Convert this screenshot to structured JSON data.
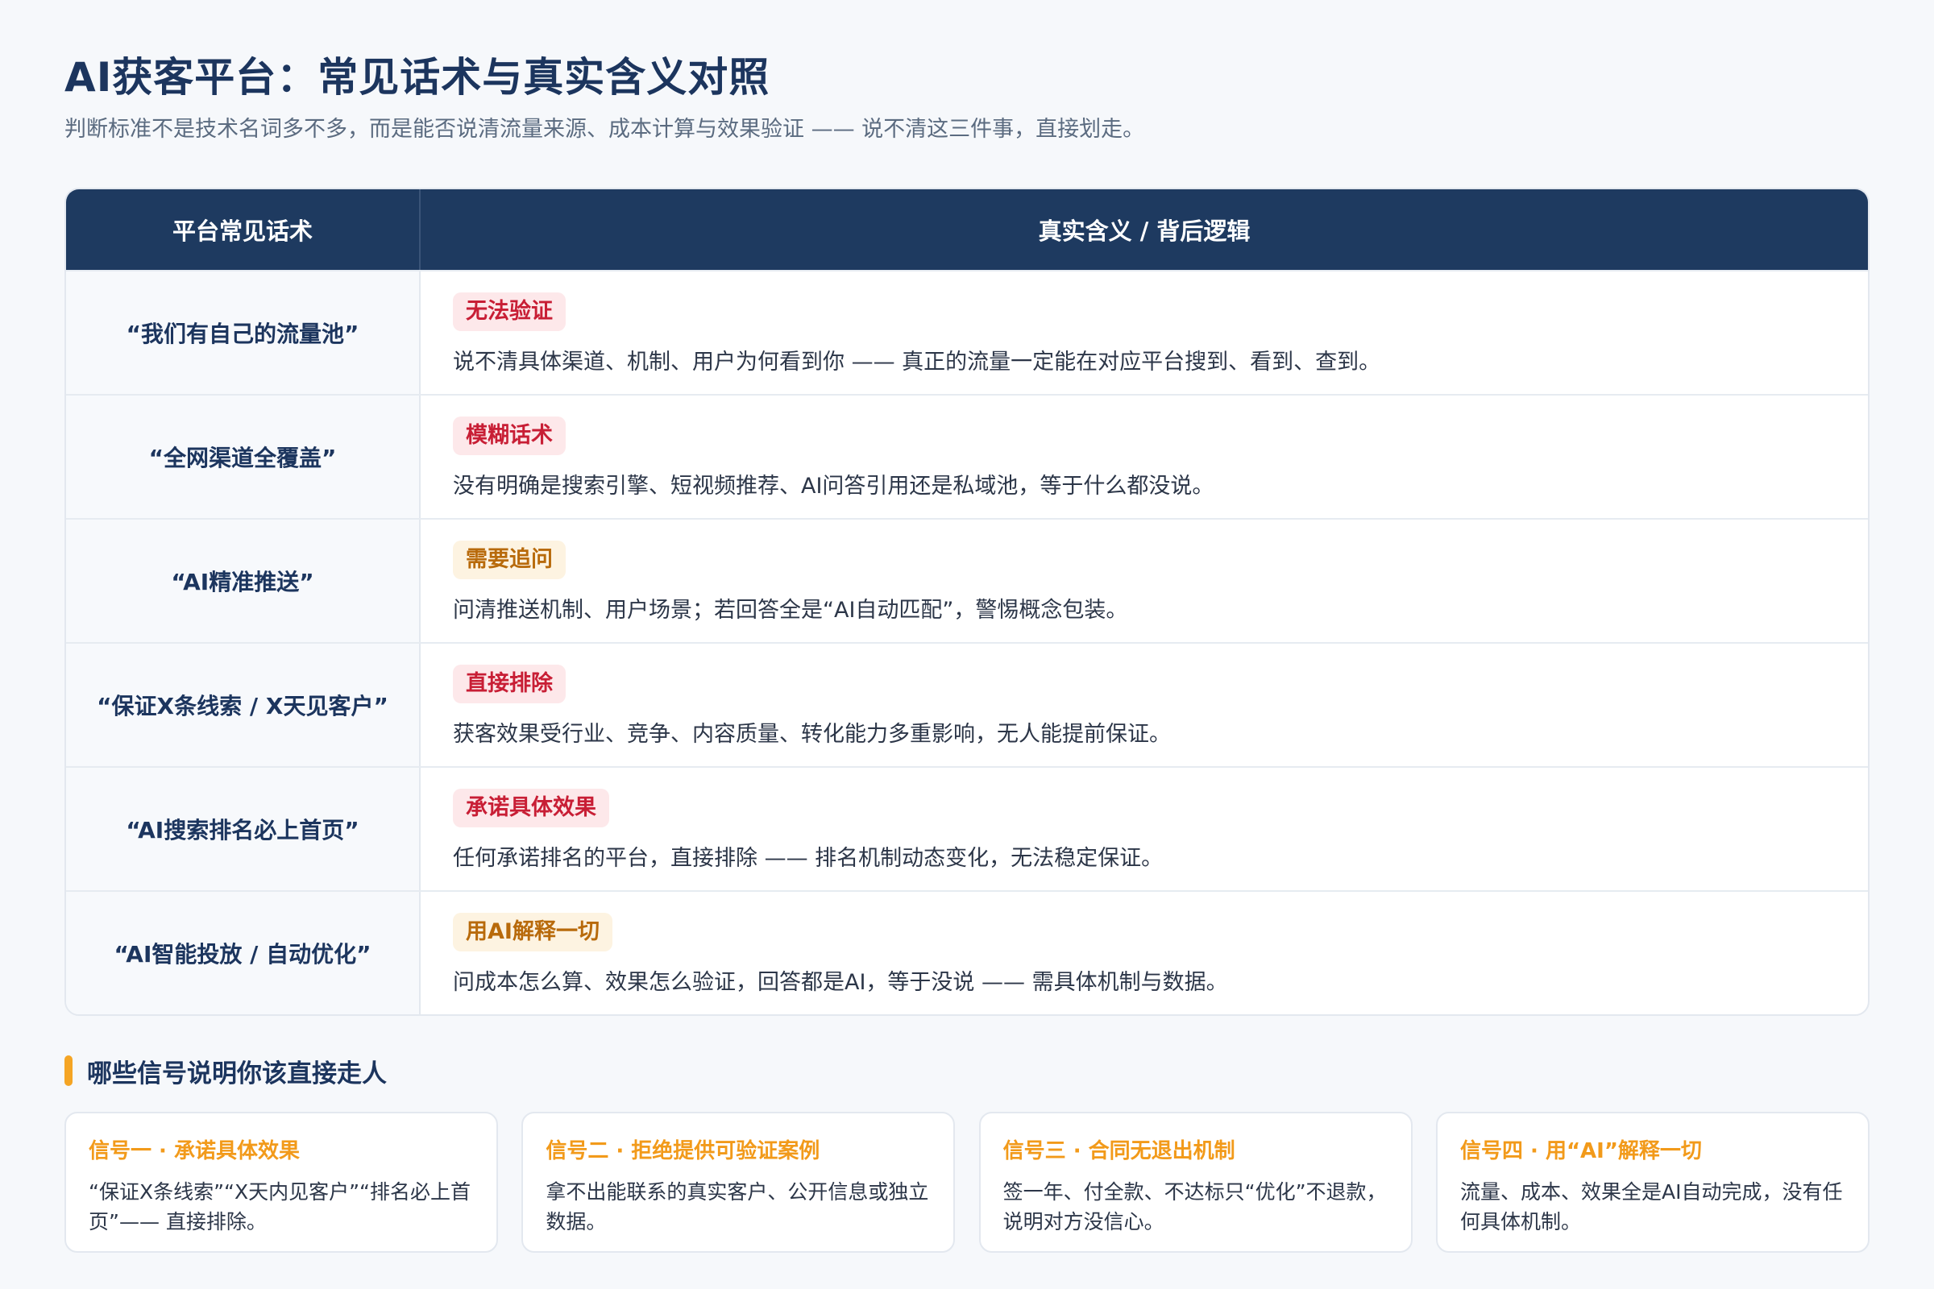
{
  "header": {
    "title": "AI获客平台：常见话术与真实含义对照",
    "subtitle": "判断标准不是技术名词多不多，而是能否说清流量来源、成本计算与效果验证 —— 说不清这三件事，直接划走。"
  },
  "table": {
    "headers": [
      "平台常见话术",
      "真实含义 / 背后逻辑"
    ],
    "rows": [
      {
        "phrase": "“我们有自己的流量池”",
        "tag": "无法验证",
        "tag_tone": "red",
        "desc": "说不清具体渠道、机制、用户为何看到你 —— 真正的流量一定能在对应平台搜到、看到、查到。"
      },
      {
        "phrase": "“全网渠道全覆盖”",
        "tag": "模糊话术",
        "tag_tone": "red",
        "desc": "没有明确是搜索引擎、短视频推荐、AI问答引用还是私域池，等于什么都没说。"
      },
      {
        "phrase": "“AI精准推送”",
        "tag": "需要追问",
        "tag_tone": "orange",
        "desc": "问清推送机制、用户场景；若回答全是“AI自动匹配”，警惕概念包装。"
      },
      {
        "phrase": "“保证X条线索 / X天见客户”",
        "tag": "直接排除",
        "tag_tone": "red",
        "desc": "获客效果受行业、竞争、内容质量、转化能力多重影响，无人能提前保证。"
      },
      {
        "phrase": "“AI搜索排名必上首页”",
        "tag": "承诺具体效果",
        "tag_tone": "red",
        "desc": "任何承诺排名的平台，直接排除 —— 排名机制动态变化，无法稳定保证。"
      },
      {
        "phrase": "“AI智能投放 / 自动优化”",
        "tag": "用AI解释一切",
        "tag_tone": "orange",
        "desc": "问成本怎么算、效果怎么验证，回答都是AI，等于没说 —— 需具体机制与数据。"
      }
    ]
  },
  "signals": {
    "title": "哪些信号说明你该直接走人",
    "cards": [
      {
        "title": "信号一 · 承诺具体效果",
        "body": "“保证X条线索”“X天内见客户”“排名必上首页”—— 直接排除。"
      },
      {
        "title": "信号二 · 拒绝提供可验证案例",
        "body": "拿不出能联系的真实客户、公开信息或独立数据。"
      },
      {
        "title": "信号三 · 合同无退出机制",
        "body": "签一年、付全款、不达标只“优化”不退款，说明对方没信心。"
      },
      {
        "title": "信号四 · 用“AI”解释一切",
        "body": "流量、成本、效果全是AI自动完成，没有任何具体机制。"
      }
    ]
  },
  "colors": {
    "header_bg": "#1e3a60",
    "title": "#1c355e",
    "tag_red": "#c81e35",
    "tag_orange": "#b86a0b",
    "accent": "#f5a524"
  }
}
